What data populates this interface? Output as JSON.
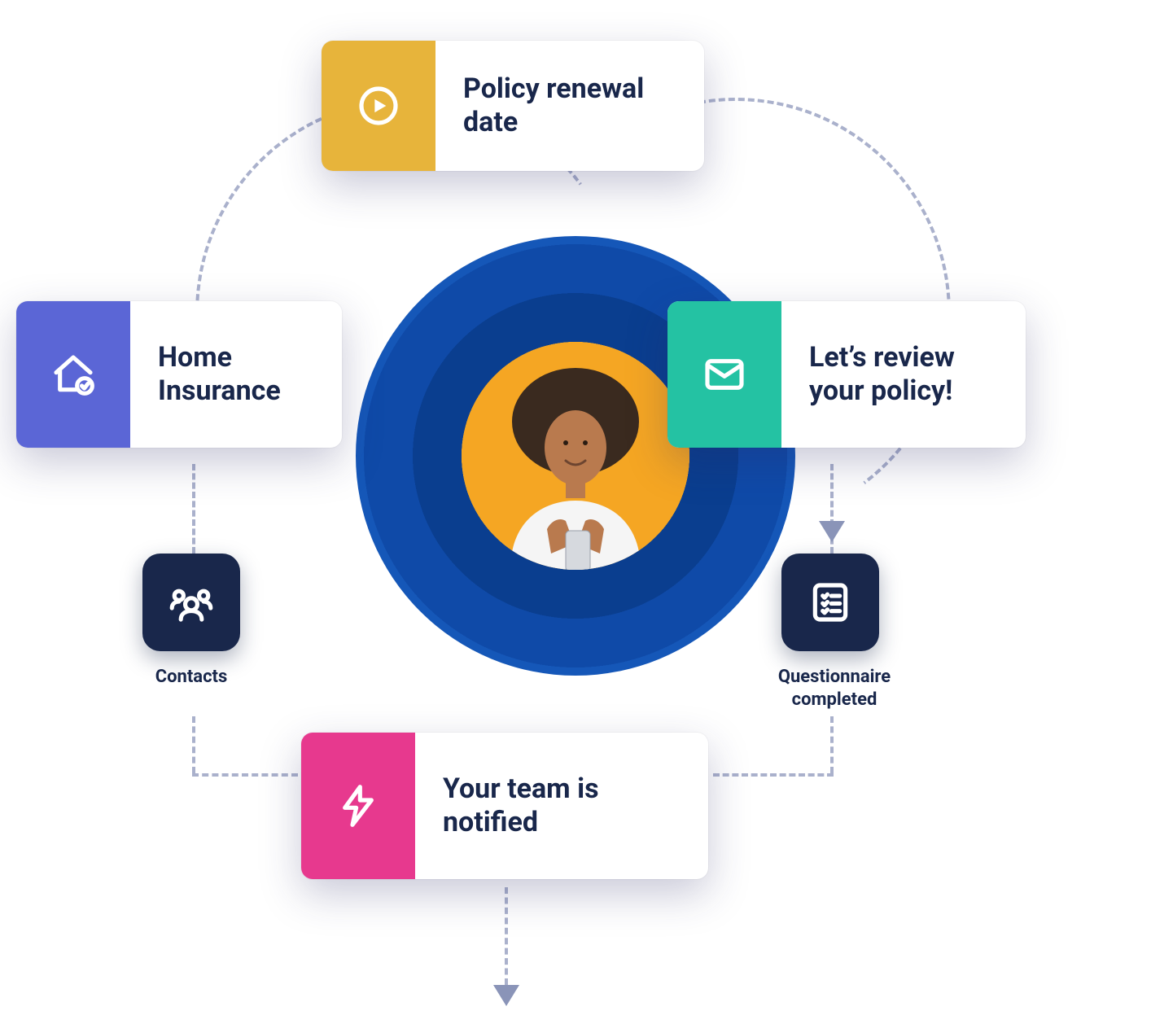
{
  "center": {
    "description": "Customer using phone"
  },
  "cards": {
    "top": {
      "label": "Policy renewal date",
      "icon": "play-circle-icon",
      "color": "#e7b43b"
    },
    "left": {
      "label": "Home Insurance",
      "icon": "home-check-icon",
      "color": "#5b66d6"
    },
    "right": {
      "label": "Let’s review your policy!",
      "icon": "envelope-icon",
      "color": "#24c2a3"
    },
    "bottom": {
      "label": "Your team is notified",
      "icon": "lightning-icon",
      "color": "#e7398e"
    }
  },
  "tiles": {
    "left": {
      "label": "Contacts",
      "icon": "users-icon"
    },
    "right": {
      "label": "Questionnaire completed",
      "icon": "checklist-icon"
    }
  },
  "colors": {
    "text": "#19274b",
    "dash": "#aab1cc",
    "radial_outer": "#1557b8",
    "radial_inner": "#0a3e8f",
    "avatar_bg": "#f5a623"
  }
}
